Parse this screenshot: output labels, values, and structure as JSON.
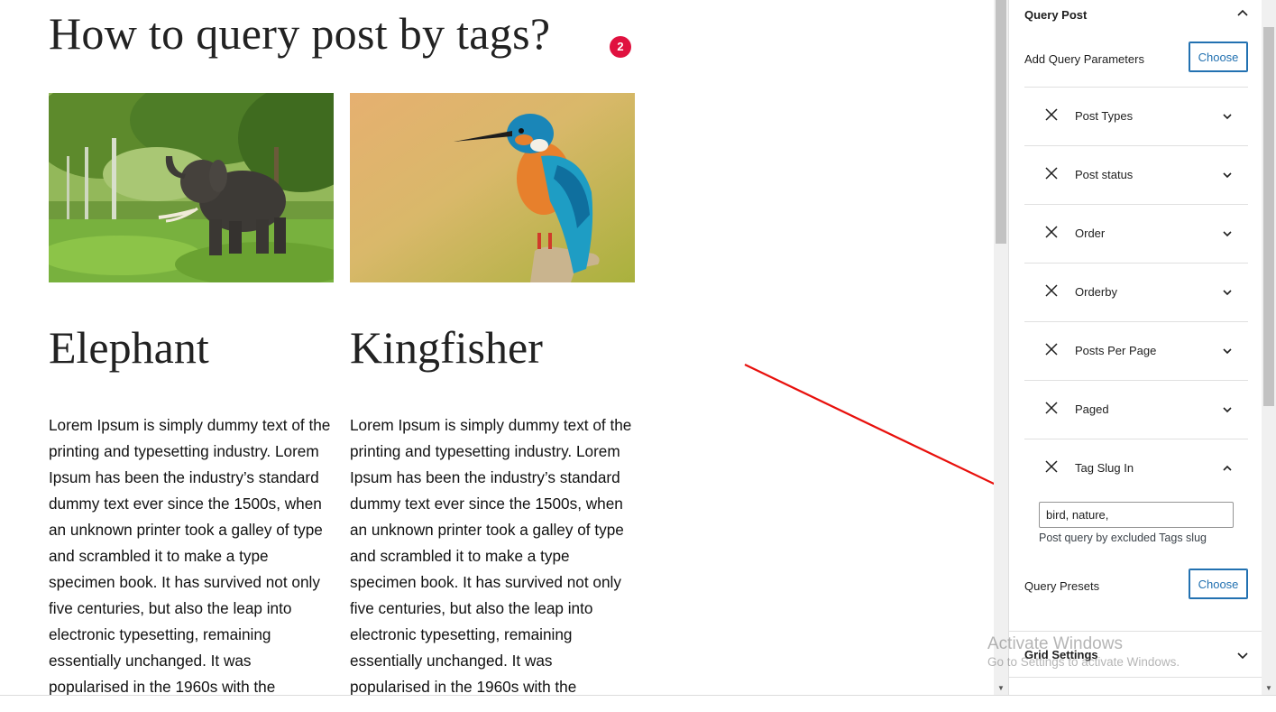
{
  "page": {
    "title": "How to query post by tags?",
    "badge_count": "2"
  },
  "posts": [
    {
      "image": "elephant-photo",
      "title": "Elephant",
      "excerpt": "Lorem Ipsum is simply dummy text of the printing and typesetting industry. Lorem Ipsum has been the industry’s standard dummy text ever since the 1500s, when an unknown printer took a galley of type and scrambled it to make a type specimen book. It has survived not only five centuries, but also the leap into electronic typesetting, remaining essentially unchanged. It was popularised in the 1960s with the"
    },
    {
      "image": "kingfisher-photo",
      "title": "Kingfisher",
      "excerpt": "Lorem Ipsum is simply dummy text of the printing and typesetting industry. Lorem Ipsum has been the industry’s standard dummy text ever since the 1500s, when an unknown printer took a galley of type and scrambled it to make a type specimen book. It has survived not only five centuries, but also the leap into electronic typesetting, remaining essentially unchanged. It was popularised in the 1960s with the"
    }
  ],
  "sidebar": {
    "panel_title": "Query Post",
    "add_params_label": "Add Query Parameters",
    "choose_label": "Choose",
    "items": [
      {
        "label": "Post Types",
        "expanded": false
      },
      {
        "label": "Post status",
        "expanded": false
      },
      {
        "label": "Order",
        "expanded": false
      },
      {
        "label": "Orderby",
        "expanded": false
      },
      {
        "label": "Posts Per Page",
        "expanded": false
      },
      {
        "label": "Paged",
        "expanded": false
      },
      {
        "label": "Tag Slug In",
        "expanded": true
      }
    ],
    "tag_input_value": "bird, nature,",
    "tag_help": "Post query by excluded Tags slug",
    "presets_label": "Query Presets",
    "presets_choose_label": "Choose",
    "grid_settings_label": "Grid Settings"
  },
  "watermark": {
    "line1": "Activate Windows",
    "line2": "Go to Settings to activate Windows."
  },
  "colors": {
    "accent": "#2271b1",
    "badge": "#e0113f",
    "arrow": "#e8100c"
  }
}
